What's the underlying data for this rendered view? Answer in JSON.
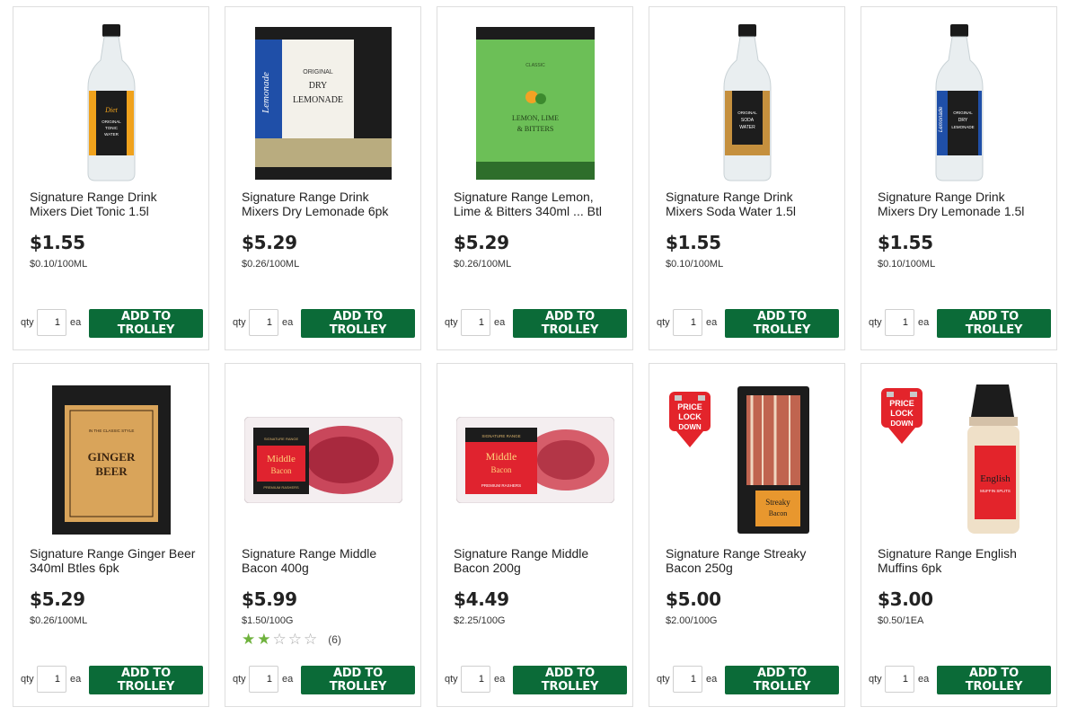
{
  "products": [
    {
      "name": "Signature Range Drink Mixers Diet Tonic 1.5l",
      "price": "$1.55",
      "unit": "$0.10/100ML",
      "qty_label": "qty",
      "qty": "1",
      "ea_label": "ea",
      "button": "ADD TO TROLLEY",
      "image": "diet-tonic-bottle",
      "label_text": [
        "Diet",
        "ORIGINAL",
        "TONIC",
        "WATER"
      ]
    },
    {
      "name": "Signature Range Drink Mixers Dry Lemonade 6pk",
      "price": "$5.29",
      "unit": "$0.26/100ML",
      "qty_label": "qty",
      "qty": "1",
      "ea_label": "ea",
      "button": "ADD TO TROLLEY",
      "image": "dry-lemonade-6pk",
      "label_text": [
        "Lemonade",
        "ORIGINAL",
        "DRY",
        "LEMONADE"
      ]
    },
    {
      "name": "Signature Range Lemon, Lime & Bitters 340ml ... Btl",
      "price": "$5.29",
      "unit": "$0.26/100ML",
      "qty_label": "qty",
      "qty": "1",
      "ea_label": "ea",
      "button": "ADD TO TROLLEY",
      "image": "lemon-lime-bitters-6pk",
      "label_text": [
        "CLASSIC",
        "LEMON, LIME",
        "& BITTERS"
      ]
    },
    {
      "name": "Signature Range Drink Mixers Soda Water 1.5l",
      "price": "$1.55",
      "unit": "$0.10/100ML",
      "qty_label": "qty",
      "qty": "1",
      "ea_label": "ea",
      "button": "ADD TO TROLLEY",
      "image": "soda-water-bottle",
      "label_text": [
        "ORIGINAL",
        "SODA",
        "WATER"
      ]
    },
    {
      "name": "Signature Range Drink Mixers Dry Lemonade 1.5l",
      "price": "$1.55",
      "unit": "$0.10/100ML",
      "qty_label": "qty",
      "qty": "1",
      "ea_label": "ea",
      "button": "ADD TO TROLLEY",
      "image": "dry-lemonade-bottle",
      "label_text": [
        "Lemonade",
        "ORIGINAL",
        "DRY",
        "LEMONADE"
      ]
    },
    {
      "name": "Signature Range Ginger Beer 340ml Btles 6pk",
      "price": "$5.29",
      "unit": "$0.26/100ML",
      "qty_label": "qty",
      "qty": "1",
      "ea_label": "ea",
      "button": "ADD TO TROLLEY",
      "image": "ginger-beer-6pk",
      "label_text": [
        "IN THE CLASSIC STYLE",
        "GINGER",
        "BEER"
      ]
    },
    {
      "name": "Signature Range Middle Bacon 400g",
      "price": "$5.99",
      "unit": "$1.50/100G",
      "qty_label": "qty",
      "qty": "1",
      "ea_label": "ea",
      "button": "ADD TO TROLLEY",
      "image": "middle-bacon-400g",
      "label_text": [
        "SIGNATURE RANGE",
        "Middle",
        "Bacon",
        "PREMIUM RASHERS"
      ],
      "rating": {
        "stars": 2,
        "max": 5,
        "count": "(6)"
      }
    },
    {
      "name": "Signature Range Middle Bacon 200g",
      "price": "$4.49",
      "unit": "$2.25/100G",
      "qty_label": "qty",
      "qty": "1",
      "ea_label": "ea",
      "button": "ADD TO TROLLEY",
      "image": "middle-bacon-200g",
      "label_text": [
        "SIGNATURE RANGE",
        "Middle",
        "Bacon",
        "PREMIUM RASHERS"
      ]
    },
    {
      "name": "Signature Range Streaky Bacon 250g",
      "price": "$5.00",
      "unit": "$2.00/100G",
      "qty_label": "qty",
      "qty": "1",
      "ea_label": "ea",
      "button": "ADD TO TROLLEY",
      "image": "streaky-bacon-250g",
      "badge": [
        "PRICE",
        "LOCK",
        "DOWN"
      ],
      "label_text": [
        "Streaky",
        "Bacon"
      ]
    },
    {
      "name": "Signature Range English Muffins 6pk",
      "price": "$3.00",
      "unit": "$0.50/1EA",
      "qty_label": "qty",
      "qty": "1",
      "ea_label": "ea",
      "button": "ADD TO TROLLEY",
      "image": "english-muffins-6pk",
      "badge": [
        "PRICE",
        "LOCK",
        "DOWN"
      ],
      "label_text": [
        "English",
        "MUFFIN SPLITS"
      ]
    }
  ],
  "colors": {
    "button": "#0b6b38",
    "star": "#6fb23d",
    "badge": "#e3242b"
  }
}
